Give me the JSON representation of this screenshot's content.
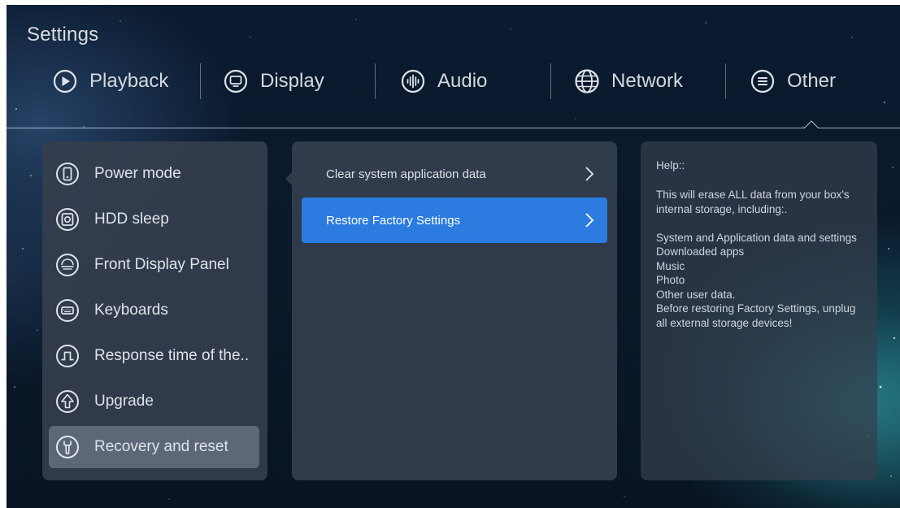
{
  "app": {
    "title": "Settings"
  },
  "tabs": [
    {
      "label": "Playback",
      "icon": "play-circle-icon"
    },
    {
      "label": "Display",
      "icon": "monitor-icon"
    },
    {
      "label": "Audio",
      "icon": "audio-wave-icon"
    },
    {
      "label": "Network",
      "icon": "globe-icon"
    },
    {
      "label": "Other",
      "icon": "menu-circle-icon"
    }
  ],
  "selected_tab": "Other",
  "sidebar": {
    "items": [
      {
        "label": "Power mode",
        "icon": "power-mode-icon"
      },
      {
        "label": "HDD sleep",
        "icon": "hdd-icon"
      },
      {
        "label": "Front Display Panel",
        "icon": "front-display-icon"
      },
      {
        "label": "Keyboards",
        "icon": "keyboard-icon"
      },
      {
        "label": "Response time of the..",
        "icon": "response-time-icon"
      },
      {
        "label": "Upgrade",
        "icon": "upgrade-icon"
      },
      {
        "label": "Recovery and reset",
        "icon": "wrench-icon"
      }
    ],
    "active": "Recovery and reset"
  },
  "options": [
    {
      "label": "Clear system application data"
    },
    {
      "label": "Restore Factory Settings"
    }
  ],
  "selected_option": "Restore Factory Settings",
  "help": {
    "title": "Help::",
    "body": " This will erase ALL data from your box's internal storage, including:.\n\n System and Application data and settings\n Downloaded apps\n Music\n Photo\n Other user data.\n Before restoring Factory Settings, unplug all external storage devices!"
  },
  "colors": {
    "selection": "#2b7be0",
    "panel": "#343e4e",
    "active_item": "#5f697a"
  }
}
